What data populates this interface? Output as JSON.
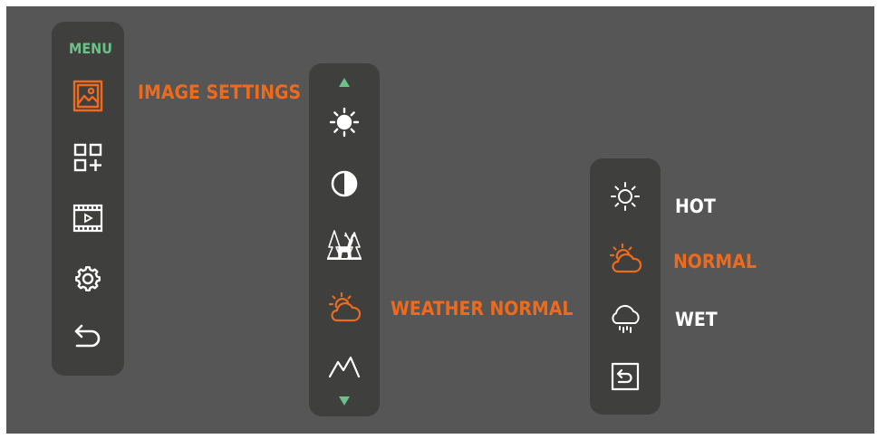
{
  "menu": {
    "title": "MENU",
    "items": [
      {
        "id": "image-settings",
        "label": "IMAGE SETTINGS",
        "icon": "image-icon",
        "active": true
      },
      {
        "id": "apps",
        "icon": "grid-add-icon",
        "active": false
      },
      {
        "id": "video",
        "icon": "film-play-icon",
        "active": false
      },
      {
        "id": "settings",
        "icon": "gear-icon",
        "active": false
      },
      {
        "id": "back",
        "icon": "back-arrow-icon",
        "active": false
      }
    ]
  },
  "image_settings": {
    "items": [
      {
        "id": "brightness",
        "icon": "brightness-icon"
      },
      {
        "id": "contrast",
        "icon": "contrast-icon"
      },
      {
        "id": "scene",
        "icon": "deer-forest-icon"
      },
      {
        "id": "weather",
        "icon": "weather-icon",
        "label": "WEATHER NORMAL",
        "active": true
      },
      {
        "id": "terrain",
        "icon": "mountain-icon"
      }
    ],
    "scroll_up_icon": "triangle-up-icon",
    "scroll_down_icon": "triangle-down-icon"
  },
  "weather": {
    "options": [
      {
        "id": "hot",
        "label": "HOT",
        "icon": "sun-icon",
        "selected": false
      },
      {
        "id": "normal",
        "label": "NORMAL",
        "icon": "sun-cloud-icon",
        "selected": true
      },
      {
        "id": "wet",
        "label": "WET",
        "icon": "rain-cloud-icon",
        "selected": false
      }
    ],
    "back_icon": "return-box-icon"
  },
  "colors": {
    "accent": "#ee6a1c",
    "menu_title": "#6cc08a",
    "arrow": "#6cc08a",
    "icon": "#ffffff",
    "panel": "#3f3f3e",
    "screen": "#565656"
  }
}
